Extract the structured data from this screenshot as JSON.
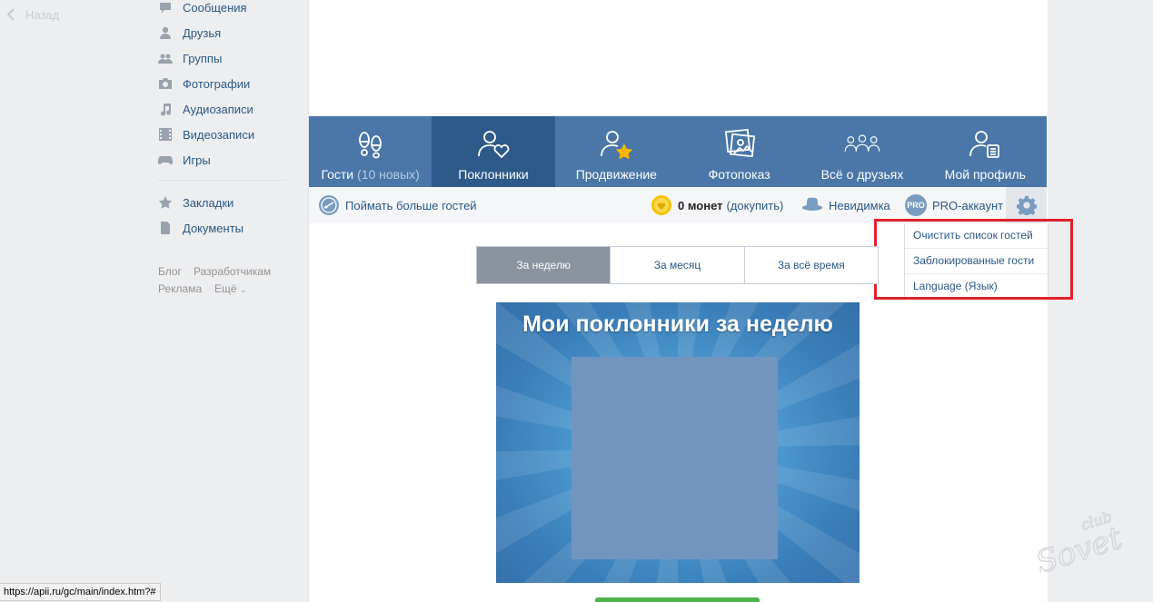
{
  "back": {
    "label": "Назад"
  },
  "sidebar": {
    "items": [
      {
        "label": "Сообщения",
        "icon": "messages-icon"
      },
      {
        "label": "Друзья",
        "icon": "friends-icon"
      },
      {
        "label": "Группы",
        "icon": "groups-icon"
      },
      {
        "label": "Фотографии",
        "icon": "camera-icon"
      },
      {
        "label": "Аудиозаписи",
        "icon": "music-note-icon"
      },
      {
        "label": "Видеозаписи",
        "icon": "film-icon"
      },
      {
        "label": "Игры",
        "icon": "gamepad-icon"
      },
      {
        "label": "Закладки",
        "icon": "star-icon"
      },
      {
        "label": "Документы",
        "icon": "document-icon"
      }
    ],
    "footer": {
      "blog": "Блог",
      "dev": "Разработчикам",
      "ads": "Реклама",
      "more": "Ещё"
    }
  },
  "apptabs": [
    {
      "label": "Гости",
      "extra": "(10 новых)",
      "icon": "footprints-icon"
    },
    {
      "label": "Поклонники",
      "icon": "user-heart-icon",
      "active": true
    },
    {
      "label": "Продвижение",
      "icon": "user-star-icon"
    },
    {
      "label": "Фотопоказ",
      "icon": "photos-icon"
    },
    {
      "label": "Всё о друзьях",
      "icon": "users-group-icon"
    },
    {
      "label": "Мой профиль",
      "icon": "user-card-icon"
    }
  ],
  "toolbar": {
    "catch_guests": "Поймать больше гостей",
    "coins": "0 монет",
    "buy": "(докупить)",
    "invisible": "Невидимка",
    "pro_badge": "PRO",
    "pro": "PRO-аккаунт"
  },
  "dropdown": [
    "Очистить список гостей",
    "Заблокированные гости",
    "Language (Язык)"
  ],
  "period": [
    "За неделю",
    "За месяц",
    "За всё время"
  ],
  "banner": {
    "title": "Мои поклонники за неделю"
  },
  "status_url": "https://apii.ru/gc/main/index.htm?#",
  "watermark": {
    "top": "club",
    "bottom": "Sovet"
  },
  "colors": {
    "header_blue": "#4a76a8",
    "active_tab": "#2e5a8a",
    "link": "#2a5885",
    "highlight_red": "#e0202a"
  }
}
